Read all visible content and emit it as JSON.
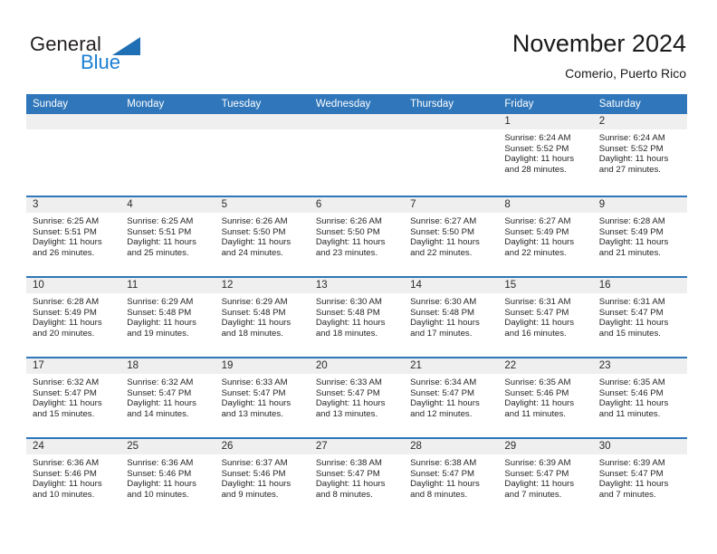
{
  "brand": {
    "name_part1": "General",
    "name_part2": "Blue",
    "triangle_icon": "triangle-logo-icon",
    "colors": {
      "dark": "#231f20",
      "blue": "#1b7fd4",
      "triangle": "#1f6fb5"
    }
  },
  "header": {
    "title": "November 2024",
    "subtitle": "Comerio, Puerto Rico"
  },
  "theme": {
    "header_bar": "#2f76ba",
    "day_band": "#efefef",
    "text": "#262626"
  },
  "calendar": {
    "weekdays": [
      "Sunday",
      "Monday",
      "Tuesday",
      "Wednesday",
      "Thursday",
      "Friday",
      "Saturday"
    ],
    "weeks": [
      [
        {
          "day": "",
          "empty": true
        },
        {
          "day": "",
          "empty": true
        },
        {
          "day": "",
          "empty": true
        },
        {
          "day": "",
          "empty": true
        },
        {
          "day": "",
          "empty": true
        },
        {
          "day": "1",
          "sunrise": "Sunrise: 6:24 AM",
          "sunset": "Sunset: 5:52 PM",
          "daylight1": "Daylight: 11 hours",
          "daylight2": "and 28 minutes."
        },
        {
          "day": "2",
          "sunrise": "Sunrise: 6:24 AM",
          "sunset": "Sunset: 5:52 PM",
          "daylight1": "Daylight: 11 hours",
          "daylight2": "and 27 minutes."
        }
      ],
      [
        {
          "day": "3",
          "sunrise": "Sunrise: 6:25 AM",
          "sunset": "Sunset: 5:51 PM",
          "daylight1": "Daylight: 11 hours",
          "daylight2": "and 26 minutes."
        },
        {
          "day": "4",
          "sunrise": "Sunrise: 6:25 AM",
          "sunset": "Sunset: 5:51 PM",
          "daylight1": "Daylight: 11 hours",
          "daylight2": "and 25 minutes."
        },
        {
          "day": "5",
          "sunrise": "Sunrise: 6:26 AM",
          "sunset": "Sunset: 5:50 PM",
          "daylight1": "Daylight: 11 hours",
          "daylight2": "and 24 minutes."
        },
        {
          "day": "6",
          "sunrise": "Sunrise: 6:26 AM",
          "sunset": "Sunset: 5:50 PM",
          "daylight1": "Daylight: 11 hours",
          "daylight2": "and 23 minutes."
        },
        {
          "day": "7",
          "sunrise": "Sunrise: 6:27 AM",
          "sunset": "Sunset: 5:50 PM",
          "daylight1": "Daylight: 11 hours",
          "daylight2": "and 22 minutes."
        },
        {
          "day": "8",
          "sunrise": "Sunrise: 6:27 AM",
          "sunset": "Sunset: 5:49 PM",
          "daylight1": "Daylight: 11 hours",
          "daylight2": "and 22 minutes."
        },
        {
          "day": "9",
          "sunrise": "Sunrise: 6:28 AM",
          "sunset": "Sunset: 5:49 PM",
          "daylight1": "Daylight: 11 hours",
          "daylight2": "and 21 minutes."
        }
      ],
      [
        {
          "day": "10",
          "sunrise": "Sunrise: 6:28 AM",
          "sunset": "Sunset: 5:49 PM",
          "daylight1": "Daylight: 11 hours",
          "daylight2": "and 20 minutes."
        },
        {
          "day": "11",
          "sunrise": "Sunrise: 6:29 AM",
          "sunset": "Sunset: 5:48 PM",
          "daylight1": "Daylight: 11 hours",
          "daylight2": "and 19 minutes."
        },
        {
          "day": "12",
          "sunrise": "Sunrise: 6:29 AM",
          "sunset": "Sunset: 5:48 PM",
          "daylight1": "Daylight: 11 hours",
          "daylight2": "and 18 minutes."
        },
        {
          "day": "13",
          "sunrise": "Sunrise: 6:30 AM",
          "sunset": "Sunset: 5:48 PM",
          "daylight1": "Daylight: 11 hours",
          "daylight2": "and 18 minutes."
        },
        {
          "day": "14",
          "sunrise": "Sunrise: 6:30 AM",
          "sunset": "Sunset: 5:48 PM",
          "daylight1": "Daylight: 11 hours",
          "daylight2": "and 17 minutes."
        },
        {
          "day": "15",
          "sunrise": "Sunrise: 6:31 AM",
          "sunset": "Sunset: 5:47 PM",
          "daylight1": "Daylight: 11 hours",
          "daylight2": "and 16 minutes."
        },
        {
          "day": "16",
          "sunrise": "Sunrise: 6:31 AM",
          "sunset": "Sunset: 5:47 PM",
          "daylight1": "Daylight: 11 hours",
          "daylight2": "and 15 minutes."
        }
      ],
      [
        {
          "day": "17",
          "sunrise": "Sunrise: 6:32 AM",
          "sunset": "Sunset: 5:47 PM",
          "daylight1": "Daylight: 11 hours",
          "daylight2": "and 15 minutes."
        },
        {
          "day": "18",
          "sunrise": "Sunrise: 6:32 AM",
          "sunset": "Sunset: 5:47 PM",
          "daylight1": "Daylight: 11 hours",
          "daylight2": "and 14 minutes."
        },
        {
          "day": "19",
          "sunrise": "Sunrise: 6:33 AM",
          "sunset": "Sunset: 5:47 PM",
          "daylight1": "Daylight: 11 hours",
          "daylight2": "and 13 minutes."
        },
        {
          "day": "20",
          "sunrise": "Sunrise: 6:33 AM",
          "sunset": "Sunset: 5:47 PM",
          "daylight1": "Daylight: 11 hours",
          "daylight2": "and 13 minutes."
        },
        {
          "day": "21",
          "sunrise": "Sunrise: 6:34 AM",
          "sunset": "Sunset: 5:47 PM",
          "daylight1": "Daylight: 11 hours",
          "daylight2": "and 12 minutes."
        },
        {
          "day": "22",
          "sunrise": "Sunrise: 6:35 AM",
          "sunset": "Sunset: 5:46 PM",
          "daylight1": "Daylight: 11 hours",
          "daylight2": "and 11 minutes."
        },
        {
          "day": "23",
          "sunrise": "Sunrise: 6:35 AM",
          "sunset": "Sunset: 5:46 PM",
          "daylight1": "Daylight: 11 hours",
          "daylight2": "and 11 minutes."
        }
      ],
      [
        {
          "day": "24",
          "sunrise": "Sunrise: 6:36 AM",
          "sunset": "Sunset: 5:46 PM",
          "daylight1": "Daylight: 11 hours",
          "daylight2": "and 10 minutes."
        },
        {
          "day": "25",
          "sunrise": "Sunrise: 6:36 AM",
          "sunset": "Sunset: 5:46 PM",
          "daylight1": "Daylight: 11 hours",
          "daylight2": "and 10 minutes."
        },
        {
          "day": "26",
          "sunrise": "Sunrise: 6:37 AM",
          "sunset": "Sunset: 5:46 PM",
          "daylight1": "Daylight: 11 hours",
          "daylight2": "and 9 minutes."
        },
        {
          "day": "27",
          "sunrise": "Sunrise: 6:38 AM",
          "sunset": "Sunset: 5:47 PM",
          "daylight1": "Daylight: 11 hours",
          "daylight2": "and 8 minutes."
        },
        {
          "day": "28",
          "sunrise": "Sunrise: 6:38 AM",
          "sunset": "Sunset: 5:47 PM",
          "daylight1": "Daylight: 11 hours",
          "daylight2": "and 8 minutes."
        },
        {
          "day": "29",
          "sunrise": "Sunrise: 6:39 AM",
          "sunset": "Sunset: 5:47 PM",
          "daylight1": "Daylight: 11 hours",
          "daylight2": "and 7 minutes."
        },
        {
          "day": "30",
          "sunrise": "Sunrise: 6:39 AM",
          "sunset": "Sunset: 5:47 PM",
          "daylight1": "Daylight: 11 hours",
          "daylight2": "and 7 minutes."
        }
      ]
    ]
  }
}
